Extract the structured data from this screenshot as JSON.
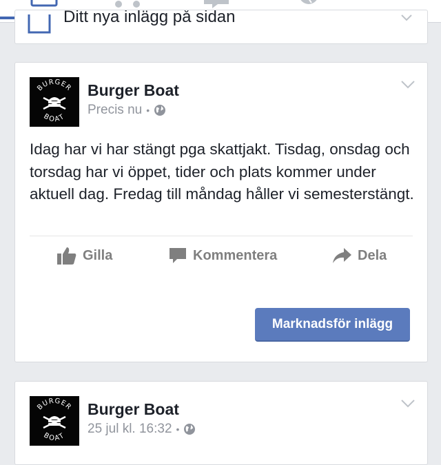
{
  "composer": {
    "placeholder": "Ditt nya inlägg på sidan"
  },
  "posts": [
    {
      "page_name": "Burger Boat",
      "timestamp": "Precis nu",
      "separator": "•",
      "privacy_icon": "globe-icon",
      "body": "Idag har vi har stängt pga skattjakt. Tisdag, onsdag och torsdag har vi öppet, tider och plats kommer under aktuell dag. Fredag till måndag håller vi semesterstängt.",
      "actions": {
        "like": "Gilla",
        "comment": "Kommentera",
        "share": "Dela"
      },
      "promote_label": "Marknadsför inlägg"
    },
    {
      "page_name": "Burger Boat",
      "timestamp": "25 jul kl. 16:32",
      "separator": "•",
      "privacy_icon": "globe-icon"
    }
  ],
  "avatar": {
    "top_text": "BURGER",
    "bottom_text": "BOAT"
  },
  "colors": {
    "background": "#e9ebee",
    "accent": "#4267b2",
    "button": "#5b7bbd",
    "secondary_text": "#90949c",
    "action_text": "#7f7f7f"
  }
}
